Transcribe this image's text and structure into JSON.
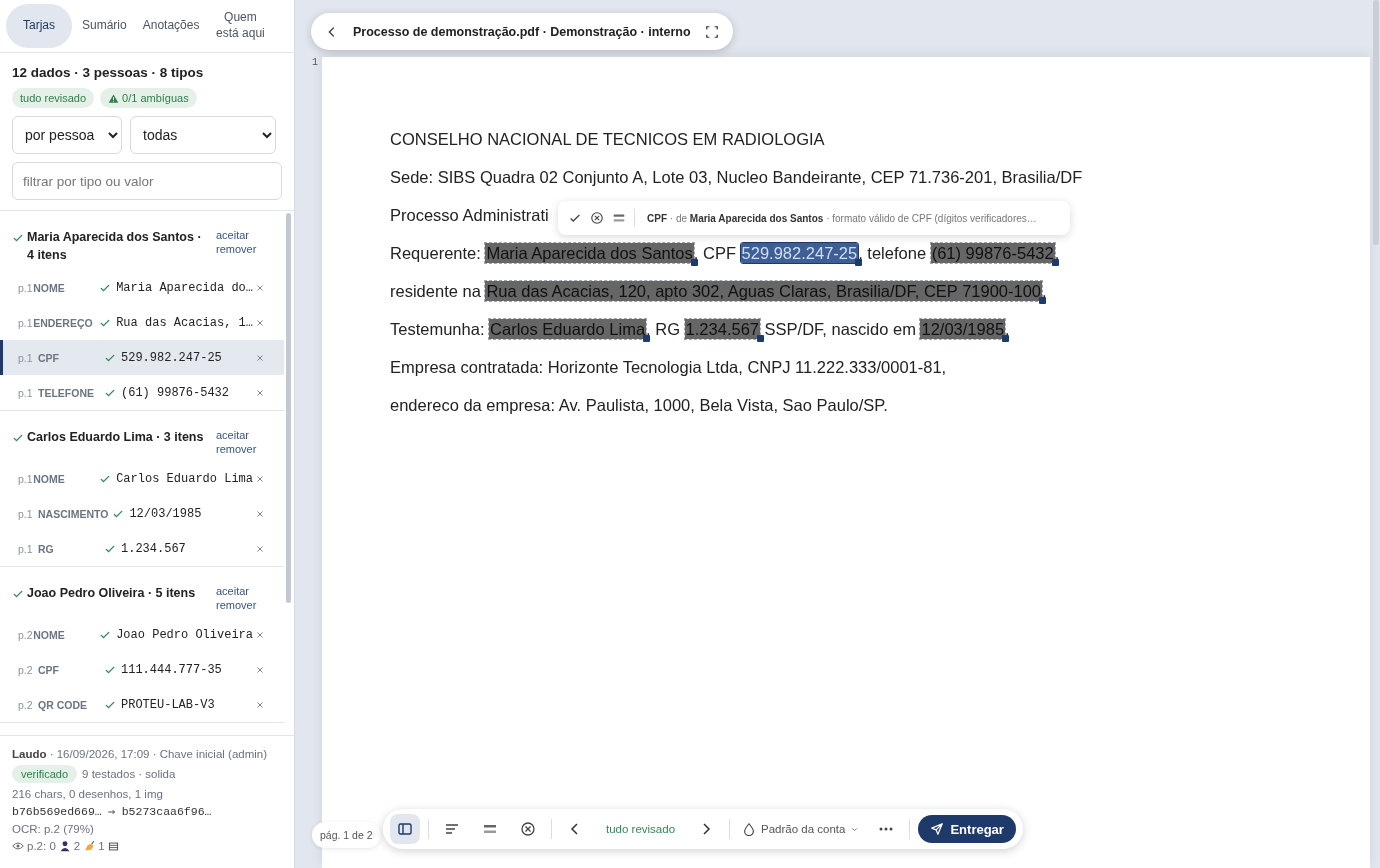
{
  "tabs": [
    {
      "label": "Tarjas",
      "selected": true
    },
    {
      "label": "Sumário",
      "selected": false
    },
    {
      "label": "Anotações",
      "selected": false
    },
    {
      "label": "Quem está aqui",
      "selected": false
    }
  ],
  "summary": {
    "title": "12 dados · 3 pessoas · 8 tipos",
    "badges": [
      {
        "kind": "plain",
        "text": "tudo revisado"
      },
      {
        "kind": "warning",
        "text": "0/1 ambíguas"
      }
    ]
  },
  "filters": {
    "group_by": "por pessoa",
    "scope": "todas",
    "search": {
      "placeholder": "filtrar por tipo ou valor"
    }
  },
  "groups": [
    {
      "title": "Maria Aparecida dos Santos · 4 itens",
      "reviewed": true,
      "accept": "aceitar",
      "remove": "remover",
      "items": [
        {
          "page": "p.1",
          "type": "NOME",
          "value": "Maria Aparecida do…",
          "reviewed": true,
          "selected": false
        },
        {
          "page": "p.1",
          "type": "ENDEREÇO",
          "value": "Rua das Acacias, 1…",
          "reviewed": true,
          "selected": false
        },
        {
          "page": "p.1",
          "type": "CPF",
          "value": "529.982.247-25",
          "reviewed": true,
          "selected": true
        },
        {
          "page": "p.1",
          "type": "TELEFONE",
          "value": "(61) 99876-5432",
          "reviewed": true,
          "selected": false
        }
      ]
    },
    {
      "title": "Carlos Eduardo Lima · 3 itens",
      "reviewed": true,
      "accept": "aceitar",
      "remove": "remover",
      "items": [
        {
          "page": "p.1",
          "type": "NOME",
          "value": "Carlos Eduardo Lima",
          "reviewed": true,
          "selected": false
        },
        {
          "page": "p.1",
          "type": "NASCIMENTO",
          "value": "12/03/1985",
          "reviewed": true,
          "selected": false
        },
        {
          "page": "p.1",
          "type": "RG",
          "value": "1.234.567",
          "reviewed": true,
          "selected": false
        }
      ]
    },
    {
      "title": "Joao Pedro Oliveira · 5 itens",
      "reviewed": true,
      "accept": "aceitar",
      "remove": "remover",
      "items": [
        {
          "page": "p.2",
          "type": "NOME",
          "value": "Joao Pedro Oliveira",
          "reviewed": true,
          "selected": false
        },
        {
          "page": "p.2",
          "type": "CPF",
          "value": "111.444.777-35",
          "reviewed": true,
          "selected": false
        },
        {
          "page": "p.2",
          "type": "QR CODE",
          "value": "PROTEU-LAB-V3",
          "reviewed": true,
          "selected": false
        }
      ]
    }
  ],
  "report": {
    "line1": "**Laudo** · 16/09/2026, 17:09 · Chave inicial (admin)",
    "status": "verificado",
    "tests": "9 testados · solida",
    "stats": "216 chars, 0 desenhos, 1 img",
    "hash_from": "b76b569ed669…",
    "hash_to": "b5273caa6f96…",
    "ocr": "OCR: p.2 (79%)",
    "presence": {
      "page": "p.2: 0",
      "people": "2",
      "signers": "1"
    }
  },
  "header": {
    "title": "Processo de demonstração.pdf · Demonstração · interno"
  },
  "page_number": "1",
  "document": {
    "lines": [
      [
        {
          "kind": "plain",
          "text": "CONSELHO NACIONAL DE TECNICOS EM RADIOLOGIA"
        }
      ],
      [
        {
          "kind": "plain",
          "text": "Sede: SIBS Quadra 02 Conjunto A, Lote 03, Nucleo Bandeirante, CEP 71.736-201, Brasilia/DF"
        }
      ],
      [
        {
          "kind": "plain",
          "text": "Processo Administrati"
        }
      ],
      [
        {
          "kind": "plain",
          "text": "Requerente: "
        },
        {
          "kind": "redacted",
          "text": "Maria Aparecida dos Santos",
          "selected": false
        },
        {
          "kind": "plain",
          "text": ", CPF "
        },
        {
          "kind": "redacted",
          "text": "529.982.247-25",
          "selected": true
        },
        {
          "kind": "plain",
          "text": ", telefone "
        },
        {
          "kind": "redacted",
          "text": "(61) 99876-5432",
          "selected": false
        },
        {
          "kind": "plain",
          "text": ","
        }
      ],
      [
        {
          "kind": "plain",
          "text": "residente na "
        },
        {
          "kind": "redacted",
          "text": "Rua das Acacias, 120, apto 302, Aguas Claras, Brasilia/DF, CEP 71900-100",
          "selected": false
        },
        {
          "kind": "plain",
          "text": ","
        }
      ],
      [
        {
          "kind": "plain",
          "text": "Testemunha: "
        },
        {
          "kind": "redacted",
          "text": "Carlos Eduardo Lima",
          "selected": false
        },
        {
          "kind": "plain",
          "text": ", RG "
        },
        {
          "kind": "redacted",
          "text": "1.234.567",
          "selected": false
        },
        {
          "kind": "plain",
          "text": " SSP/DF, nascido em "
        },
        {
          "kind": "redacted",
          "text": "12/03/1985",
          "selected": false
        },
        {
          "kind": "plain",
          "text": "."
        }
      ],
      [
        {
          "kind": "plain",
          "text": "Empresa contratada: Horizonte Tecnologia Ltda, CNPJ 11.222.333/0001-81,"
        }
      ],
      [
        {
          "kind": "plain",
          "text": "endereco da empresa: Av. Paulista, 1000, Bela Vista, Sao Paulo/SP."
        }
      ]
    ]
  },
  "popover": {
    "text": "**CPF** · de **Maria Aparecida dos Santos** · formato válido de CPF (dígitos verificadores…"
  },
  "page_indicator": "pág. 1 de 2",
  "toolbar": {
    "sidebar_toggle": {
      "selected": true
    },
    "status": "tudo revisado",
    "style_label": "Padrão da conta",
    "submit": "Entregar"
  }
}
